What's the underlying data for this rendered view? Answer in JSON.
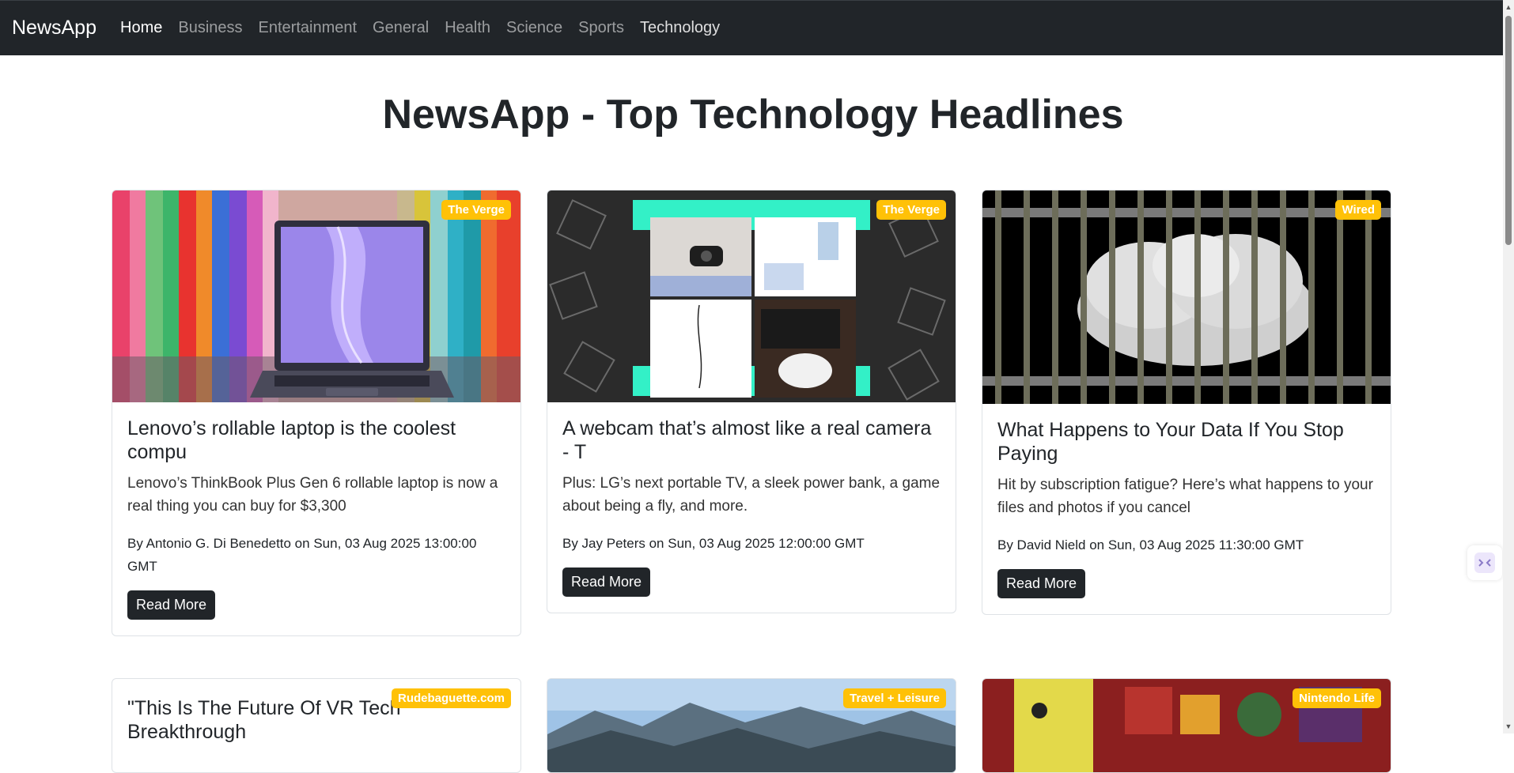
{
  "navbar": {
    "brand": "NewsApp",
    "links": [
      "Home",
      "Business",
      "Entertainment",
      "General",
      "Health",
      "Science",
      "Sports",
      "Technology"
    ]
  },
  "page": {
    "title": "NewsApp - Top Technology Headlines"
  },
  "articles": [
    {
      "source": "The Verge",
      "title": "Lenovo’s rollable laptop is the coolest compu",
      "description": "Lenovo’s ThinkBook Plus Gen 6 rollable laptop is now a real thing you can buy for $3,300",
      "byline": "By Antonio G. Di Benedetto on Sun, 03 Aug 2025 13:00:00 GMT",
      "button": "Read More"
    },
    {
      "source": "The Verge",
      "title": "A webcam that’s almost like a real camera - T",
      "description": "Plus: LG’s next portable TV, a sleek power bank, a game about being a fly, and more.",
      "byline": "By Jay Peters on Sun, 03 Aug 2025 12:00:00 GMT",
      "button": "Read More"
    },
    {
      "source": "Wired",
      "title": "What Happens to Your Data If You Stop Paying",
      "description": "Hit by subscription fatigue? Here’s what happens to your files and photos if you cancel",
      "byline": "By David Nield on Sun, 03 Aug 2025 11:30:00 GMT",
      "button": "Read More"
    },
    {
      "source": "Rudebaguette.com",
      "title": "\"This Is The Future Of VR Tech Breakthrough"
    },
    {
      "source": "Travel + Leisure"
    },
    {
      "source": "Nintendo Life"
    }
  ],
  "colors": {
    "navbar": "#212529",
    "badge": "#ffc107",
    "button": "#212529"
  }
}
